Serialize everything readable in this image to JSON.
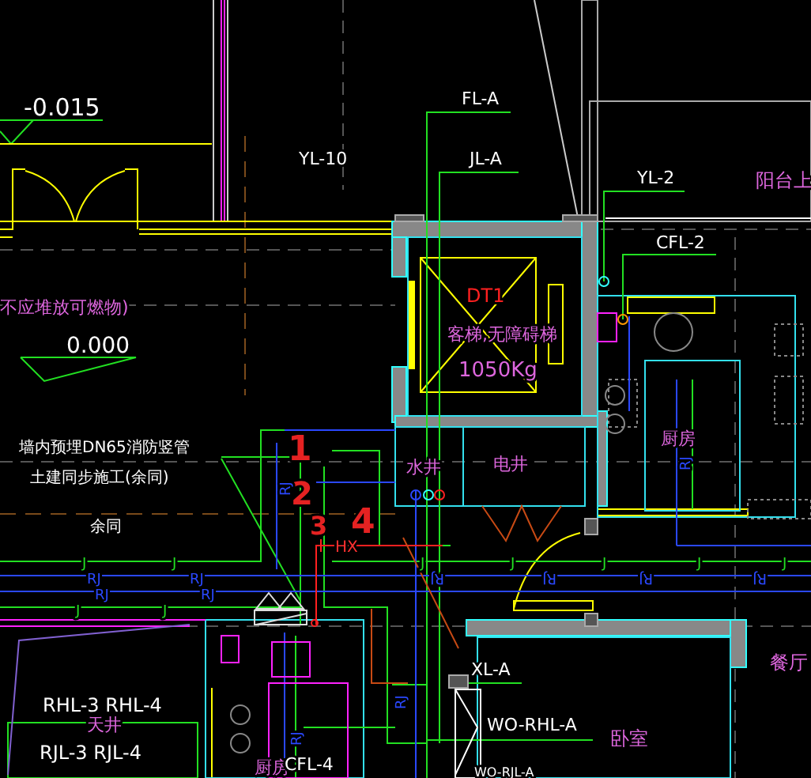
{
  "labels": [
    {
      "text": "-0.015",
      "kind": "elevation"
    },
    {
      "text": "不应堆放可燃物)",
      "kind": "room-label"
    },
    {
      "text": "0.000",
      "kind": "elevation"
    },
    {
      "text": "YL-10",
      "kind": "pipe-label"
    },
    {
      "text": "FL-A",
      "kind": "pipe-label"
    },
    {
      "text": "JL-A",
      "kind": "pipe-label"
    },
    {
      "text": "YL-2",
      "kind": "pipe-label"
    },
    {
      "text": "CFL-2",
      "kind": "pipe-label"
    },
    {
      "text": "阳台上",
      "kind": "room-label"
    },
    {
      "text": "DT1",
      "kind": "elevator-id"
    },
    {
      "text": "客梯,无障碍梯",
      "kind": "room-label"
    },
    {
      "text": "1050Kg",
      "kind": "room-label"
    },
    {
      "text": "墙内预埋DN65消防竖管",
      "kind": "note"
    },
    {
      "text": "土建同步施工(余同)",
      "kind": "note"
    },
    {
      "text": "余同",
      "kind": "note"
    },
    {
      "text": "1",
      "kind": "markup"
    },
    {
      "text": "2",
      "kind": "markup"
    },
    {
      "text": "3",
      "kind": "markup"
    },
    {
      "text": "4",
      "kind": "markup"
    },
    {
      "text": "水井",
      "kind": "room-label"
    },
    {
      "text": "电井",
      "kind": "room-label"
    },
    {
      "text": "厨房",
      "kind": "room-label"
    },
    {
      "text": "HX",
      "kind": "equipment-code"
    },
    {
      "text": "J",
      "kind": "water-tag"
    },
    {
      "text": "J",
      "kind": "water-tag"
    },
    {
      "text": "RJ",
      "kind": "hot-water-tag"
    },
    {
      "text": "RJ",
      "kind": "hot-water-tag"
    },
    {
      "text": "RJ",
      "kind": "hot-water-tag"
    },
    {
      "text": "RJ",
      "kind": "hot-water-tag"
    },
    {
      "text": "J",
      "kind": "water-tag"
    },
    {
      "text": "J",
      "kind": "water-tag"
    },
    {
      "text": "J",
      "kind": "water-tag"
    },
    {
      "text": "J",
      "kind": "water-tag"
    },
    {
      "text": "J",
      "kind": "water-tag"
    },
    {
      "text": "J",
      "kind": "water-tag"
    },
    {
      "text": "J",
      "kind": "water-tag"
    },
    {
      "text": "RJ",
      "kind": "hot-water-tag"
    },
    {
      "text": "RJ",
      "kind": "hot-water-tag"
    },
    {
      "text": "RJ",
      "kind": "hot-water-tag"
    },
    {
      "text": "RJ",
      "kind": "hot-water-tag"
    },
    {
      "text": "RJ",
      "kind": "hot-water-tag"
    },
    {
      "text": "RJ",
      "kind": "hot-water-tag"
    },
    {
      "text": "RJ",
      "kind": "hot-water-tag"
    },
    {
      "text": "RJ",
      "kind": "hot-water-tag"
    },
    {
      "text": "RHL-3 RHL-4",
      "kind": "pipe-label"
    },
    {
      "text": "天井",
      "kind": "room-label"
    },
    {
      "text": "RJL-3 RJL-4",
      "kind": "pipe-label"
    },
    {
      "text": "厨房",
      "kind": "room-label"
    },
    {
      "text": "CFL-4",
      "kind": "pipe-label"
    },
    {
      "text": "XL-A",
      "kind": "pipe-label"
    },
    {
      "text": "WO-RHL-A",
      "kind": "pipe-label"
    },
    {
      "text": "卧室",
      "kind": "room-label"
    },
    {
      "text": "餐厅",
      "kind": "room-label"
    },
    {
      "text": "WO-RJL-A",
      "kind": "pipe-label"
    }
  ]
}
